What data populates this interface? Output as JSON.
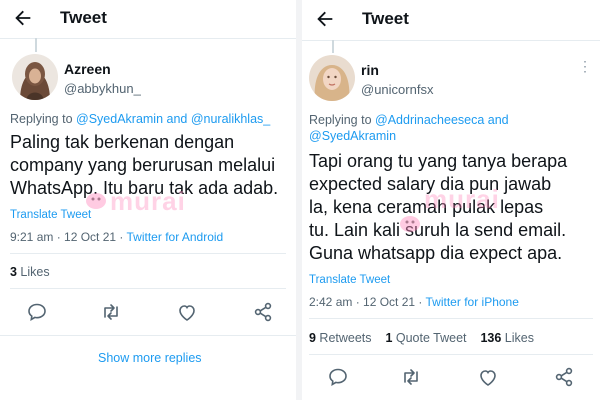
{
  "left": {
    "header_title": "Tweet",
    "user_name": "Azreen",
    "handle": "@abbykhun_",
    "replying_prefix": "Replying to ",
    "replying_mentions": "@SyedAkramin and @nuralikhlas_",
    "body_lines": [
      "Paling tak berkenan dengan",
      "company yang berurusan melalui",
      "WhatsApp. Itu baru tak ada adab."
    ],
    "translate": "Translate Tweet",
    "timestamp": "9:21 am · 12 Oct 21 · ",
    "source": "Twitter for Android",
    "likes_count": "3",
    "likes_label": " Likes",
    "show_more": "Show more replies"
  },
  "right": {
    "header_title": "Tweet",
    "user_name": "rin",
    "handle": "@unicornfsx",
    "replying_prefix": "Replying to ",
    "replying_mentions_1": "@Addrinacheeseca and",
    "replying_mentions_2": "@SyedAkramin",
    "body_lines": [
      "Tapi orang tu yang tanya berapa",
      "expected salary dia pun jawab",
      "la, kena ceramah pulak lepas",
      "tu. Lain kali suruh la send email.",
      "Guna whatsapp dia expect apa."
    ],
    "translate": "Translate Tweet",
    "timestamp": "2:42 am · 12 Oct 21 · ",
    "source": "Twitter for iPhone",
    "retweets_count": "9",
    "retweets_label": " Retweets",
    "quotes_count": "1",
    "quotes_label": " Quote Tweet",
    "likes_count": "136",
    "likes_label": " Likes"
  },
  "watermark": "murai",
  "icons": {
    "back": "arrow-left-icon",
    "more": "more-dots-icon",
    "reply": "reply-icon",
    "retweet": "retweet-icon",
    "like": "heart-icon",
    "share": "share-icon"
  },
  "colors": {
    "link": "#1d9bf0",
    "secondary_text": "#536471",
    "text": "#0f1419"
  }
}
